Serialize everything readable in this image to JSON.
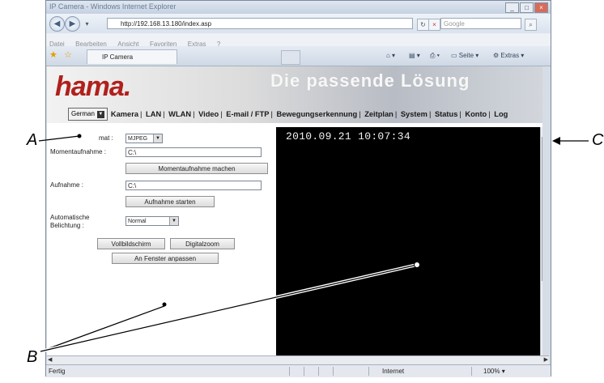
{
  "callouts": {
    "a": "A",
    "b": "B",
    "c": "C"
  },
  "browser": {
    "title": "IP Camera - Windows Internet Explorer",
    "url": "http://192.168.13.180/index.asp",
    "search_placeholder": "Google",
    "menu": [
      "Datei",
      "Bearbeiten",
      "Ansicht",
      "Favoriten",
      "Extras",
      "?"
    ],
    "tab_title": "IP Camera",
    "toolbar_right": {
      "page": "Seite",
      "extras": "Extras"
    },
    "status": "Fertig",
    "zone": "Internet",
    "zoom": "100%"
  },
  "header": {
    "logo": "hama.",
    "tagline": "Die passende Lösung",
    "language": "German"
  },
  "nav": [
    "Kamera",
    "LAN",
    "WLAN",
    "Video",
    "E-mail / FTP",
    "Bewegungserkennung",
    "Zeitplan",
    "System",
    "Status",
    "Konto",
    "Log"
  ],
  "form": {
    "format_label": "mat :",
    "format_value": "MJPEG",
    "snapshot_label": "Momentaufnahme :",
    "snapshot_path": "C:\\",
    "snapshot_button": "Momentaufnahme machen",
    "record_label": "Aufnahme :",
    "record_path": "C:\\",
    "record_button": "Aufnahme starten",
    "exposure_label": "Automatische Belichtung :",
    "exposure_value": "Normal",
    "fullscreen_button": "Vollbildschirm",
    "digizoom_button": "Digitalzoom",
    "fit_button": "An Fenster anpassen"
  },
  "video": {
    "timestamp": "2010.09.21 10:07:34"
  }
}
